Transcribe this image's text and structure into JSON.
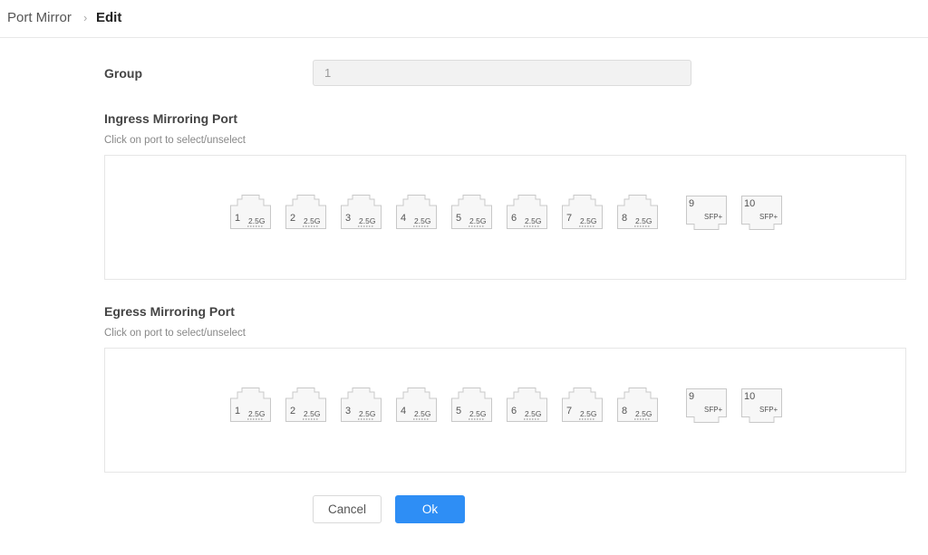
{
  "breadcrumb": {
    "parent": "Port Mirror",
    "separator": "›",
    "current": "Edit"
  },
  "group": {
    "label": "Group",
    "value": "1"
  },
  "ingress": {
    "title": "Ingress Mirroring Port",
    "hint": "Click on port to select/unselect",
    "ports": [
      {
        "num": "1",
        "speed": "2.5G",
        "type": "rj45"
      },
      {
        "num": "2",
        "speed": "2.5G",
        "type": "rj45"
      },
      {
        "num": "3",
        "speed": "2.5G",
        "type": "rj45"
      },
      {
        "num": "4",
        "speed": "2.5G",
        "type": "rj45"
      },
      {
        "num": "5",
        "speed": "2.5G",
        "type": "rj45"
      },
      {
        "num": "6",
        "speed": "2.5G",
        "type": "rj45"
      },
      {
        "num": "7",
        "speed": "2.5G",
        "type": "rj45"
      },
      {
        "num": "8",
        "speed": "2.5G",
        "type": "rj45"
      },
      {
        "num": "9",
        "speed": "SFP+",
        "type": "sfp"
      },
      {
        "num": "10",
        "speed": "SFP+",
        "type": "sfp"
      }
    ]
  },
  "egress": {
    "title": "Egress Mirroring Port",
    "hint": "Click on port to select/unselect",
    "ports": [
      {
        "num": "1",
        "speed": "2.5G",
        "type": "rj45"
      },
      {
        "num": "2",
        "speed": "2.5G",
        "type": "rj45"
      },
      {
        "num": "3",
        "speed": "2.5G",
        "type": "rj45"
      },
      {
        "num": "4",
        "speed": "2.5G",
        "type": "rj45"
      },
      {
        "num": "5",
        "speed": "2.5G",
        "type": "rj45"
      },
      {
        "num": "6",
        "speed": "2.5G",
        "type": "rj45"
      },
      {
        "num": "7",
        "speed": "2.5G",
        "type": "rj45"
      },
      {
        "num": "8",
        "speed": "2.5G",
        "type": "rj45"
      },
      {
        "num": "9",
        "speed": "SFP+",
        "type": "sfp"
      },
      {
        "num": "10",
        "speed": "SFP+",
        "type": "sfp"
      }
    ]
  },
  "actions": {
    "cancel_label": "Cancel",
    "ok_label": "Ok"
  },
  "colors": {
    "primary": "#2e8ef5",
    "port_outline": "#c8c8c8",
    "port_fill": "#f7f7f7"
  }
}
